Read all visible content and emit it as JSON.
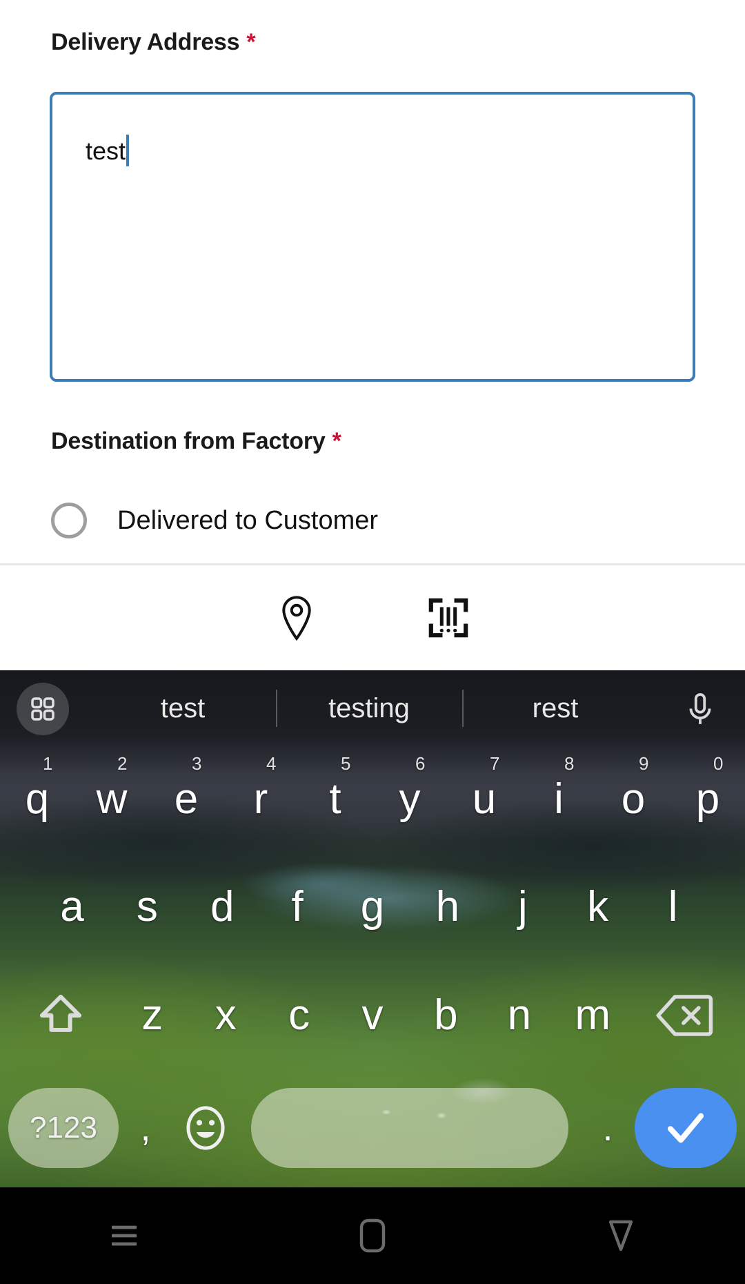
{
  "form": {
    "delivery": {
      "label": "Delivery Address",
      "required_marker": "*",
      "value": "test",
      "placeholder": ""
    },
    "destination": {
      "label": "Destination from Factory",
      "required_marker": "*",
      "options": [
        {
          "label": "Delivered to Customer",
          "selected": false
        }
      ]
    }
  },
  "toolbar": {
    "icons": [
      {
        "name": "location-pin-icon",
        "label": "Location"
      },
      {
        "name": "barcode-scan-icon",
        "label": "Scan Barcode"
      }
    ]
  },
  "keyboard": {
    "suggestions": [
      "test",
      "testing",
      "rest"
    ],
    "grid_icon": "grid-icon",
    "mic_icon": "microphone-icon",
    "row1": [
      {
        "key": "q",
        "num": "1"
      },
      {
        "key": "w",
        "num": "2"
      },
      {
        "key": "e",
        "num": "3"
      },
      {
        "key": "r",
        "num": "4"
      },
      {
        "key": "t",
        "num": "5"
      },
      {
        "key": "y",
        "num": "6"
      },
      {
        "key": "u",
        "num": "7"
      },
      {
        "key": "i",
        "num": "8"
      },
      {
        "key": "o",
        "num": "9"
      },
      {
        "key": "p",
        "num": "0"
      }
    ],
    "row2": [
      "a",
      "s",
      "d",
      "f",
      "g",
      "h",
      "j",
      "k",
      "l"
    ],
    "row3": [
      "z",
      "x",
      "c",
      "v",
      "b",
      "n",
      "m"
    ],
    "shift_icon": "shift-key-icon",
    "backspace_icon": "backspace-key-icon",
    "symbols_label": "?123",
    "comma_label": ",",
    "emoji_icon": "emoji-key-icon",
    "space_label": "",
    "period_label": ".",
    "enter_icon": "checkmark-enter-icon"
  },
  "navbar": {
    "buttons": [
      {
        "name": "recents-button",
        "icon": "menu-icon"
      },
      {
        "name": "home-button",
        "icon": "home-square-icon"
      },
      {
        "name": "back-button",
        "icon": "back-triangle-icon"
      }
    ]
  },
  "colors": {
    "field_focus_border": "#3c7cb5",
    "required_star": "#cc1133",
    "enter_key": "#4a90f0",
    "radio_outline": "#9e9e9e"
  }
}
